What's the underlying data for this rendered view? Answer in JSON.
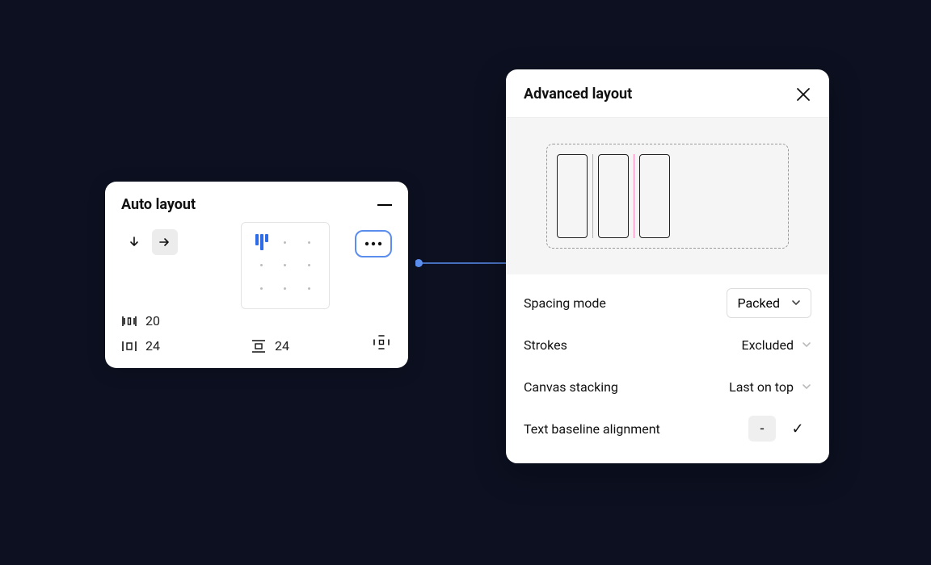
{
  "autoLayout": {
    "title": "Auto layout",
    "direction": "horizontal",
    "itemSpacing": "20",
    "paddingHorizontal": "24",
    "paddingVertical": "24"
  },
  "advancedLayout": {
    "title": "Advanced layout",
    "options": {
      "spacingMode": {
        "label": "Spacing mode",
        "value": "Packed"
      },
      "strokes": {
        "label": "Strokes",
        "value": "Excluded"
      },
      "canvasStack": {
        "label": "Canvas stacking",
        "value": "Last on top"
      },
      "baseline": {
        "label": "Text baseline alignment",
        "off": "-",
        "on": "✓"
      }
    }
  }
}
